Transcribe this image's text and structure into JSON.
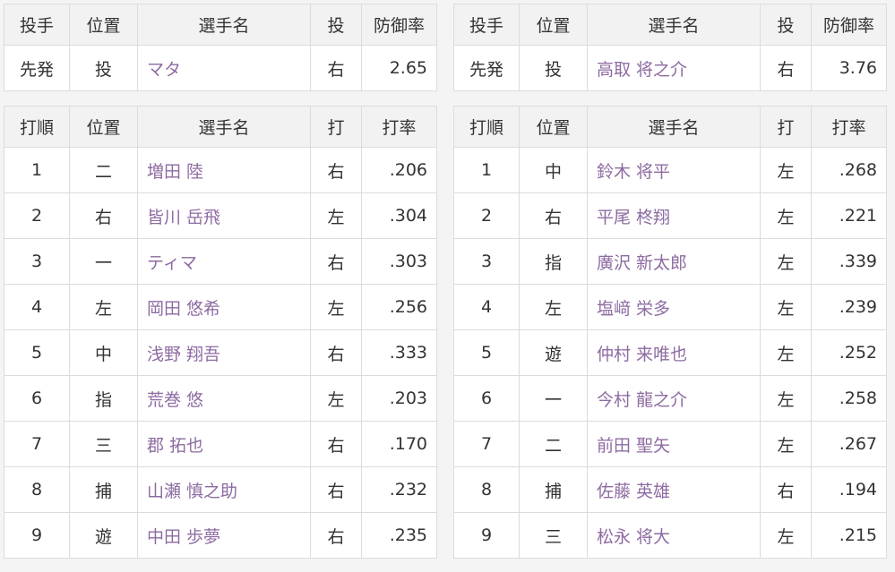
{
  "headers": {
    "pitcher": [
      "投手",
      "位置",
      "選手名",
      "投",
      "防御率"
    ],
    "batter": [
      "打順",
      "位置",
      "選手名",
      "打",
      "打率"
    ]
  },
  "home": {
    "pitcher": {
      "role": "先発",
      "pos": "投",
      "name": "マタ",
      "hand": "右",
      "era": "2.65"
    },
    "lineup": [
      {
        "order": "1",
        "pos": "二",
        "name": "増田 陸",
        "hand": "右",
        "avg": ".206"
      },
      {
        "order": "2",
        "pos": "右",
        "name": "皆川 岳飛",
        "hand": "左",
        "avg": ".304"
      },
      {
        "order": "3",
        "pos": "一",
        "name": "ティマ",
        "hand": "右",
        "avg": ".303"
      },
      {
        "order": "4",
        "pos": "左",
        "name": "岡田 悠希",
        "hand": "左",
        "avg": ".256"
      },
      {
        "order": "5",
        "pos": "中",
        "name": "浅野 翔吾",
        "hand": "右",
        "avg": ".333"
      },
      {
        "order": "6",
        "pos": "指",
        "name": "荒巻 悠",
        "hand": "左",
        "avg": ".203"
      },
      {
        "order": "7",
        "pos": "三",
        "name": "郡 拓也",
        "hand": "右",
        "avg": ".170"
      },
      {
        "order": "8",
        "pos": "捕",
        "name": "山瀬 慎之助",
        "hand": "右",
        "avg": ".232"
      },
      {
        "order": "9",
        "pos": "遊",
        "name": "中田 歩夢",
        "hand": "右",
        "avg": ".235"
      }
    ]
  },
  "away": {
    "pitcher": {
      "role": "先発",
      "pos": "投",
      "name": "高取 将之介",
      "hand": "右",
      "era": "3.76"
    },
    "lineup": [
      {
        "order": "1",
        "pos": "中",
        "name": "鈴木 将平",
        "hand": "左",
        "avg": ".268"
      },
      {
        "order": "2",
        "pos": "右",
        "name": "平尾 柊翔",
        "hand": "左",
        "avg": ".221"
      },
      {
        "order": "3",
        "pos": "指",
        "name": "廣沢 新太郎",
        "hand": "左",
        "avg": ".339"
      },
      {
        "order": "4",
        "pos": "左",
        "name": "塩﨑 栄多",
        "hand": "左",
        "avg": ".239"
      },
      {
        "order": "5",
        "pos": "遊",
        "name": "仲村 来唯也",
        "hand": "左",
        "avg": ".252"
      },
      {
        "order": "6",
        "pos": "一",
        "name": "今村 龍之介",
        "hand": "左",
        "avg": ".258"
      },
      {
        "order": "7",
        "pos": "二",
        "name": "前田 聖矢",
        "hand": "左",
        "avg": ".267"
      },
      {
        "order": "8",
        "pos": "捕",
        "name": "佐藤 英雄",
        "hand": "右",
        "avg": ".194"
      },
      {
        "order": "9",
        "pos": "三",
        "name": "松永 将大",
        "hand": "左",
        "avg": ".215"
      }
    ]
  },
  "colors": {
    "link": "#8d6ba1",
    "header_bg": "#f2f2f2",
    "border": "#dcdcdc"
  }
}
